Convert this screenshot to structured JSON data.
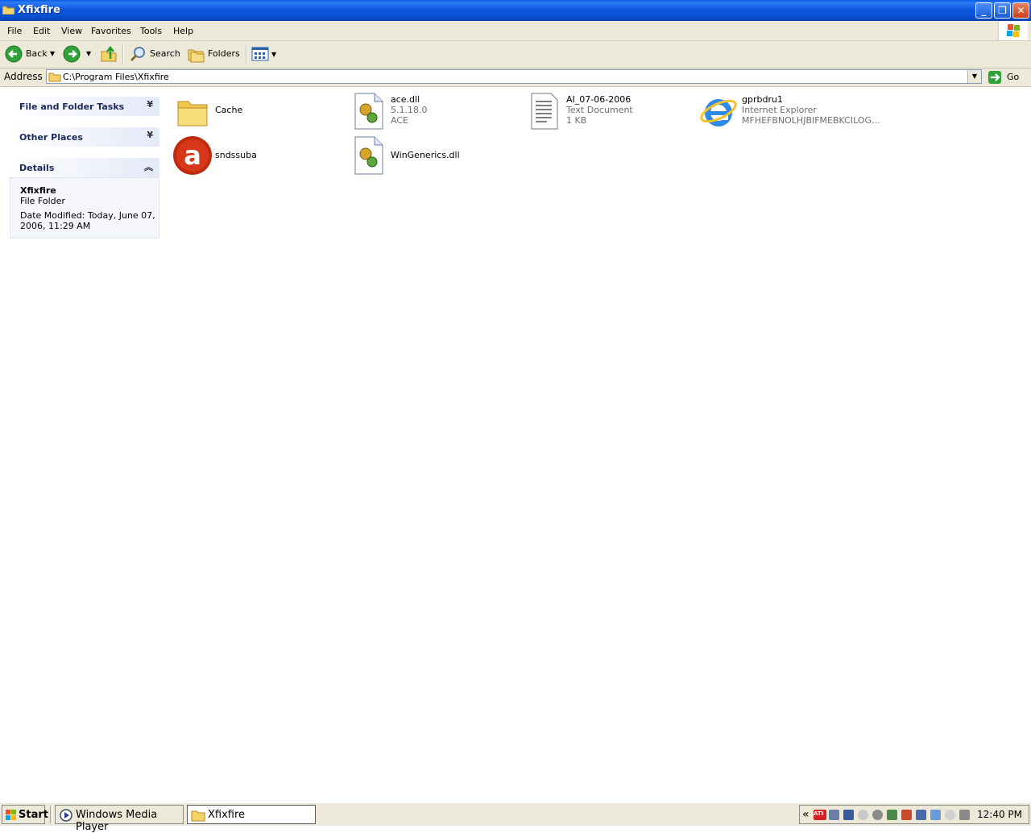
{
  "window": {
    "title": "Xfixfire"
  },
  "menu": [
    "File",
    "Edit",
    "View",
    "Favorites",
    "Tools",
    "Help"
  ],
  "toolbar": {
    "back_label": "Back",
    "search_label": "Search",
    "folders_label": "Folders"
  },
  "address": {
    "label": "Address",
    "path": "C:\\Program Files\\Xfixfire",
    "go_label": "Go"
  },
  "sidebar": {
    "tasks_title": "File and Folder Tasks",
    "other_title": "Other Places",
    "details_title": "Details",
    "details_name": "Xfixfire",
    "details_type": "File Folder",
    "details_date_line1": "Date Modified: Today, June 07,",
    "details_date_line2": "2006, 11:29 AM"
  },
  "files": [
    {
      "name": "Cache",
      "icon": "folder-icon"
    },
    {
      "name": "ace.dll",
      "line2": "5.1.18.0",
      "line3": "ACE",
      "icon": "dll-gear-icon"
    },
    {
      "name": "AI_07-06-2006",
      "line2": "Text Document",
      "line3": "1 KB",
      "icon": "text-document-icon"
    },
    {
      "name": "gprbdru1",
      "line2": "Internet Explorer",
      "line3": "MFHEFBNOLHJBIFMEBKCILOG...",
      "icon": "internet-explorer-icon"
    },
    {
      "name": "sndssuba",
      "icon": "red-a-icon"
    },
    {
      "name": "WinGenerics.dll",
      "icon": "dll-gear-icon"
    }
  ],
  "taskbar": {
    "start_label": "Start",
    "task1": "Windows Media Player",
    "task2": "Xfixfire",
    "clock": "12:40 PM",
    "tray_chevron": "«",
    "ati_label": "ATI"
  },
  "colors": {
    "titlebar": "#0a55dd",
    "chrome": "#ece9d8",
    "panel_title": "#1b2a5a"
  }
}
